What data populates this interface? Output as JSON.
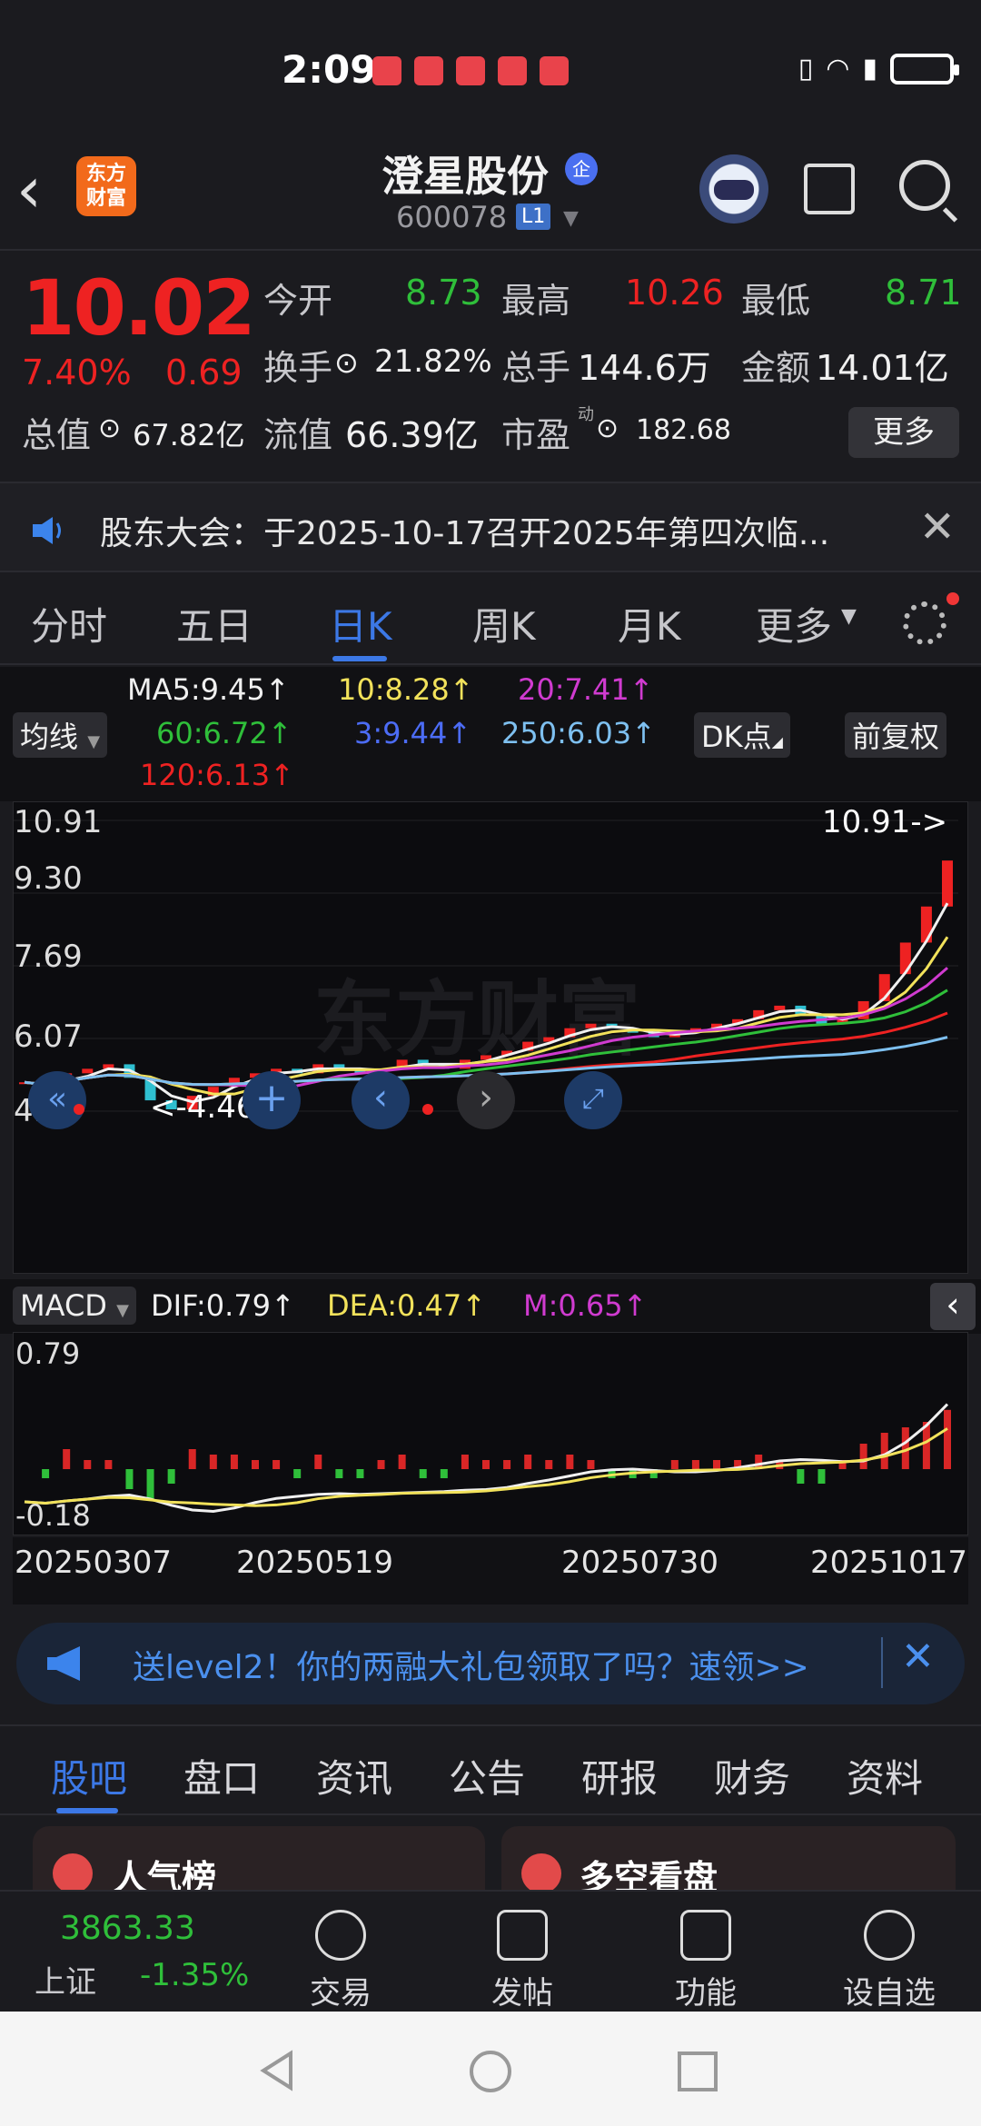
{
  "status_bar": {
    "time": "2:09"
  },
  "header": {
    "logo_text": "东方\n财富",
    "stock_name": "澄星股份",
    "enterprise_badge": "企",
    "code": "600078",
    "level_badge": "L1"
  },
  "quote": {
    "price": "10.02",
    "change_pct": "7.40%",
    "change": "0.69",
    "fields": [
      {
        "label": "今开",
        "value": "8.73"
      },
      {
        "label": "最高",
        "value": "10.26"
      },
      {
        "label": "最低",
        "value": "8.71"
      },
      {
        "label": "换手",
        "value": "21.82%"
      },
      {
        "label": "总手",
        "value": "144.6万"
      },
      {
        "label": "金额",
        "value": "14.01亿"
      },
      {
        "label": "总值",
        "value": "67.82亿"
      },
      {
        "label": "流值",
        "value": "66.39亿"
      },
      {
        "label": "市盈",
        "value": "182.68"
      }
    ],
    "pe_superscript": "动",
    "more_label": "更多"
  },
  "notice": {
    "text": "股东大会：于2025-10-17召开2025年第四次临..."
  },
  "period_tabs": [
    "分时",
    "五日",
    "日K",
    "周K",
    "月K",
    "更多"
  ],
  "active_period": "日K",
  "ma": {
    "selector": "均线",
    "ma5": "MA5:9.45↑",
    "ma10": "10:8.28↑",
    "ma20": "20:7.41↑",
    "ma60": "60:6.72↑",
    "ma3": "3:9.44↑",
    "ma250": "250:6.03↑",
    "ma120": "120:6.13↑",
    "dk_label": "DK点",
    "adjust_label": "前复权"
  },
  "chart_data": {
    "type": "line",
    "y_ticks": [
      "10.91",
      "9.30",
      "7.69",
      "6.07",
      "4.46"
    ],
    "high_label": "10.91->",
    "low_label": "<-4.46",
    "watermark": "东方财富",
    "x_dates": [
      "20250307",
      "20250519",
      "20250730",
      "20251017"
    ],
    "close": [
      5.1,
      5.0,
      5.3,
      5.4,
      5.5,
      5.2,
      4.7,
      4.5,
      4.8,
      5.0,
      5.2,
      5.3,
      5.4,
      5.3,
      5.5,
      5.4,
      5.3,
      5.4,
      5.6,
      5.5,
      5.4,
      5.6,
      5.7,
      5.8,
      6.0,
      6.1,
      6.3,
      6.4,
      6.3,
      6.2,
      6.1,
      6.2,
      6.3,
      6.4,
      6.5,
      6.7,
      6.8,
      6.6,
      6.4,
      6.5,
      6.9,
      7.5,
      8.2,
      9.0,
      10.02
    ],
    "macd": {
      "dif": "DIF:0.79↑",
      "dea": "DEA:0.47↑",
      "m": "M:0.65↑",
      "y_ticks": [
        "0.79",
        "-0.18"
      ],
      "selector": "MACD"
    }
  },
  "banner": {
    "text": "送level2！你的两融大礼包领取了吗？速领>>"
  },
  "sub_tabs": [
    "股吧",
    "盘口",
    "资讯",
    "公告",
    "研报",
    "财务",
    "资料"
  ],
  "active_sub_tab": "股吧",
  "cards": [
    {
      "title": "人气榜"
    },
    {
      "title": "多空看盘"
    }
  ],
  "bottom_bar": {
    "index_value": "3863.33",
    "index_name": "上证",
    "index_change": "-1.35%",
    "items": [
      "交易",
      "发帖",
      "功能",
      "设自选"
    ]
  }
}
